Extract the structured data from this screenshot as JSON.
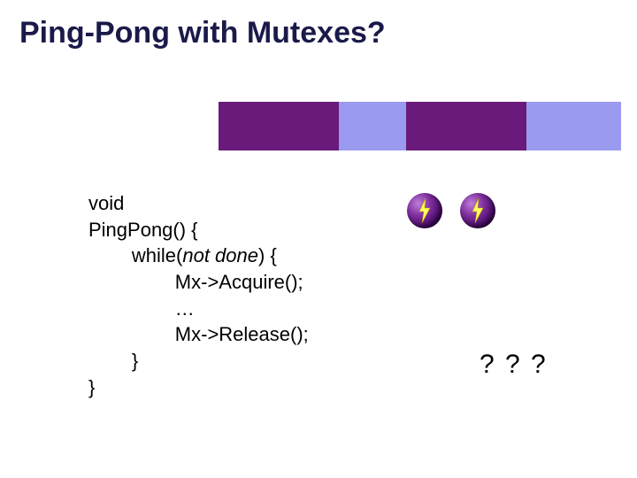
{
  "title": "Ping-Pong with Mutexes?",
  "code": {
    "l1": "void",
    "l2": "PingPong() {",
    "l3": "        while(",
    "cond": "not done",
    "l3b": ") {",
    "l4": "                Mx->Acquire();",
    "l5": "                …",
    "l6": "                Mx->Release();",
    "l7": "        }",
    "l8": "}"
  },
  "qmarks": "? ? ?",
  "icons": {
    "bolt": "lightning-bolt-icon"
  }
}
